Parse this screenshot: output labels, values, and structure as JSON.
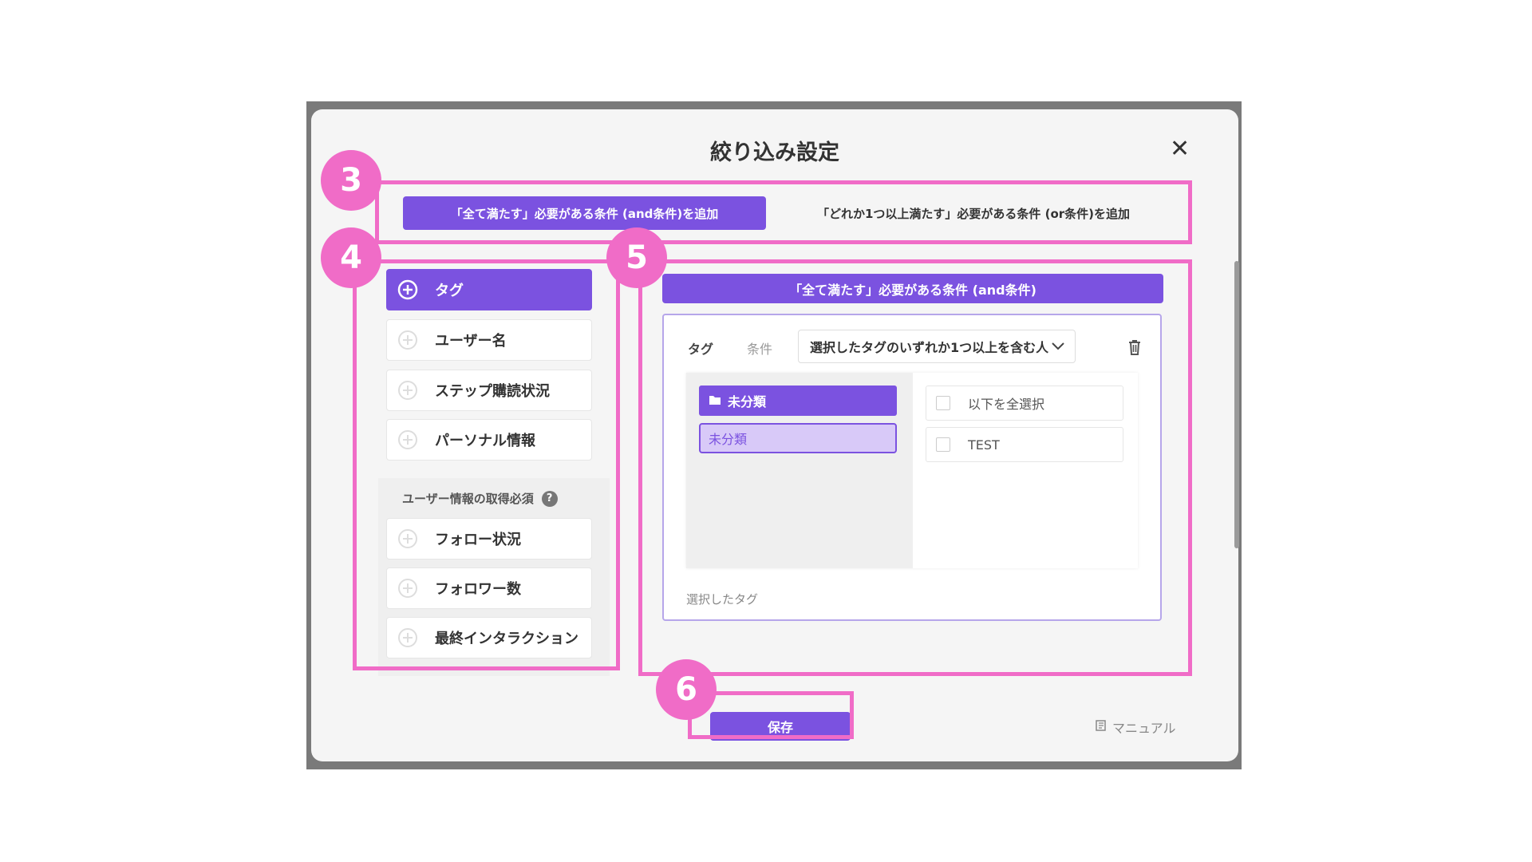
{
  "dialog": {
    "title": "絞り込み設定",
    "close_label": "✕"
  },
  "tabs": {
    "and_label": "「全て満たす」必要がある条件 (and条件)を追加",
    "or_label": "「どれか1つ以上満たす」必要がある条件 (or条件)を追加"
  },
  "left_menu": {
    "items": [
      {
        "label": "タグ",
        "icon": "plus-circle-icon",
        "active": true
      },
      {
        "label": "ユーザー名",
        "icon": "plus-circle-icon",
        "active": false
      },
      {
        "label": "ステップ購読状況",
        "icon": "plus-circle-icon",
        "active": false
      },
      {
        "label": "パーソナル情報",
        "icon": "plus-circle-icon",
        "active": false
      }
    ],
    "section_title": "ユーザー情報の取得必須",
    "help_icon": "?",
    "section_items": [
      {
        "label": "フォロー状況",
        "icon": "plus-circle-icon"
      },
      {
        "label": "フォロワー数",
        "icon": "plus-circle-icon"
      },
      {
        "label": "最終インタラクション",
        "icon": "plus-circle-icon"
      }
    ]
  },
  "condition": {
    "header": "「全て満たす」必要がある条件 (and条件)",
    "tag_label": "タグ",
    "cond_label": "条件",
    "select_value": "選択したタグのいずれか1つ以上を含む人",
    "folder": "未分類",
    "folder_sub": "未分類",
    "options": [
      "以下を全選択",
      "TEST"
    ],
    "selected_tags_label": "選択したタグ"
  },
  "footer": {
    "save_label": "保存",
    "manual_label": "マニュアル"
  },
  "annotations": {
    "badges": [
      "3",
      "4",
      "5",
      "6"
    ]
  },
  "colors": {
    "accent": "#7b52e0",
    "annotation": "#f06cc7"
  }
}
